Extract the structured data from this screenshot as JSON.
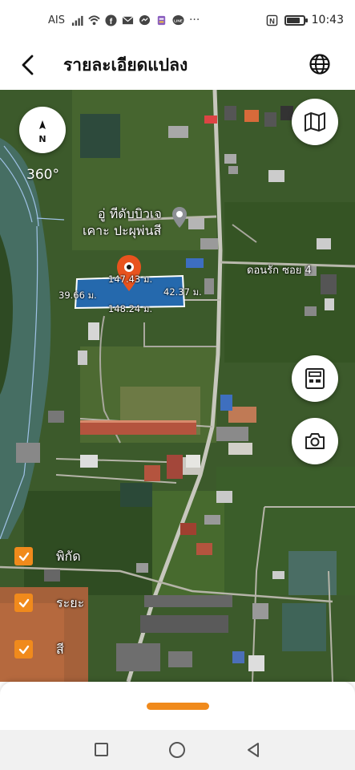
{
  "status_bar": {
    "carrier": "AIS",
    "time": "10:43",
    "icons": [
      "signal-icon",
      "wifi-icon",
      "facebook-icon",
      "mail-icon",
      "messenger-icon",
      "app-icon",
      "line-icon",
      "more-icon",
      "nfc-icon",
      "battery-icon"
    ]
  },
  "header": {
    "title": "รายละเอียดแปลง",
    "back_icon": "back-arrow-icon",
    "language_icon": "globe-icon"
  },
  "map": {
    "compass_label": "N",
    "rotation_label": "360°",
    "poi_line1": "อู่ ทีดับบิวเจ",
    "poi_line2": "เคาะ ปะผุพ่นสี",
    "road_label": "ดอนรัก ซอย 4",
    "plot": {
      "top_length": "147.43 ม.",
      "left_length": "39.66 ม.",
      "right_length": "42.37 ม.",
      "bottom_length": "148.24 ม."
    },
    "buttons": {
      "map_type_icon": "map-icon",
      "calculator_icon": "calculator-icon",
      "camera_icon": "camera-icon"
    },
    "layers": [
      {
        "label": "พิกัด",
        "checked": true
      },
      {
        "label": "ระยะ",
        "checked": true
      },
      {
        "label": "สี",
        "checked": true
      }
    ]
  },
  "colors": {
    "accent": "#f08a1c",
    "pin": "#e8531e",
    "plot_fill": "#1e6fd9"
  }
}
